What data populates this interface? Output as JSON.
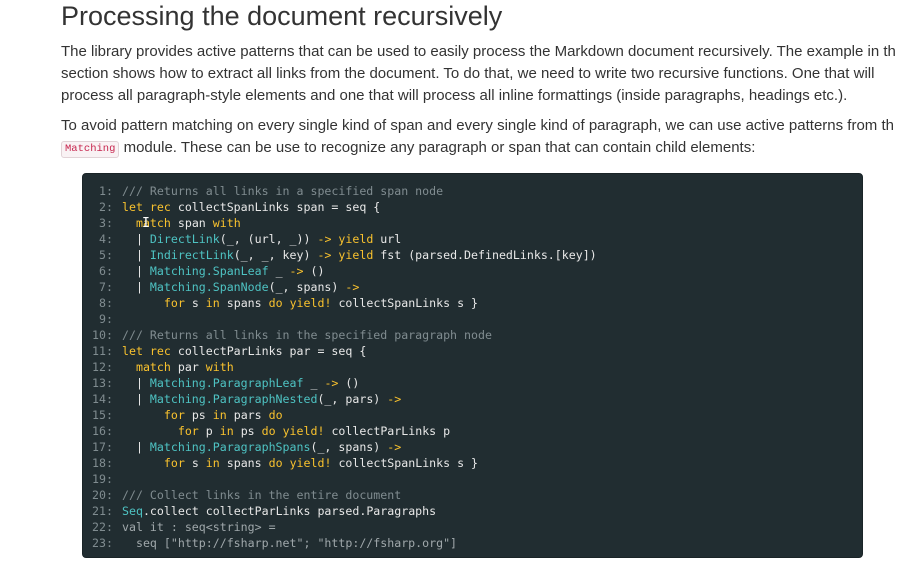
{
  "heading": "Processing the document recursively",
  "paragraph1": {
    "lines": [
      "The library provides active patterns that can be used to easily process the Markdown document recursively. The example in th",
      "section shows how to extract all links from the document. To do that, we need to write two recursive functions. One that will",
      "process all paragraph-style elements and one that will process all inline formattings (inside paragraphs, headings etc.)."
    ]
  },
  "paragraph2": {
    "line1": "To avoid pattern matching on every single kind of span and every single kind of paragraph, we can use active patterns from th",
    "inline_code": "Matching",
    "line2_rest": " module. These can be use to recognize any paragraph or span that can contain child elements:"
  },
  "code": {
    "lines": [
      {
        "n": "1:",
        "tokens": [
          [
            "com",
            "/// Returns all links in a specified span node"
          ]
        ]
      },
      {
        "n": "2:",
        "tokens": [
          [
            "kw",
            "let rec "
          ],
          [
            "id",
            "collectSpanLinks span = seq {"
          ]
        ]
      },
      {
        "n": "3:",
        "tokens": [
          [
            "id",
            "  "
          ],
          [
            "kw",
            "match "
          ],
          [
            "id",
            "span "
          ],
          [
            "kw",
            "with"
          ]
        ]
      },
      {
        "n": "4:",
        "tokens": [
          [
            "id",
            "  | "
          ],
          [
            "ty",
            "DirectLink"
          ],
          [
            "id",
            "(_, (url, _)) "
          ],
          [
            "kw",
            "-> yield "
          ],
          [
            "id",
            "url"
          ]
        ]
      },
      {
        "n": "5:",
        "tokens": [
          [
            "id",
            "  | "
          ],
          [
            "ty",
            "IndirectLink"
          ],
          [
            "id",
            "(_, _, key) "
          ],
          [
            "kw",
            "-> yield "
          ],
          [
            "id",
            "fst (parsed.DefinedLinks.[key])"
          ]
        ]
      },
      {
        "n": "6:",
        "tokens": [
          [
            "id",
            "  | "
          ],
          [
            "ty",
            "Matching.SpanLeaf"
          ],
          [
            "id",
            " _ "
          ],
          [
            "kw",
            "-> "
          ],
          [
            "id",
            "()"
          ]
        ]
      },
      {
        "n": "7:",
        "tokens": [
          [
            "id",
            "  | "
          ],
          [
            "ty",
            "Matching.SpanNode"
          ],
          [
            "id",
            "(_, spans) "
          ],
          [
            "kw",
            "->"
          ]
        ]
      },
      {
        "n": "8:",
        "tokens": [
          [
            "id",
            "      "
          ],
          [
            "kw",
            "for "
          ],
          [
            "id",
            "s "
          ],
          [
            "kw",
            "in "
          ],
          [
            "id",
            "spans "
          ],
          [
            "kw",
            "do yield! "
          ],
          [
            "id",
            "collectSpanLinks s }"
          ]
        ]
      },
      {
        "n": "9:",
        "tokens": []
      },
      {
        "n": "10:",
        "tokens": [
          [
            "com",
            "/// Returns all links in the specified paragraph node"
          ]
        ]
      },
      {
        "n": "11:",
        "tokens": [
          [
            "kw",
            "let rec "
          ],
          [
            "id",
            "collectParLinks par = seq {"
          ]
        ]
      },
      {
        "n": "12:",
        "tokens": [
          [
            "id",
            "  "
          ],
          [
            "kw",
            "match "
          ],
          [
            "id",
            "par "
          ],
          [
            "kw",
            "with"
          ]
        ]
      },
      {
        "n": "13:",
        "tokens": [
          [
            "id",
            "  | "
          ],
          [
            "ty",
            "Matching.ParagraphLeaf"
          ],
          [
            "id",
            " _ "
          ],
          [
            "kw",
            "-> "
          ],
          [
            "id",
            "()"
          ]
        ]
      },
      {
        "n": "14:",
        "tokens": [
          [
            "id",
            "  | "
          ],
          [
            "ty",
            "Matching.ParagraphNested"
          ],
          [
            "id",
            "(_, pars) "
          ],
          [
            "kw",
            "->"
          ]
        ]
      },
      {
        "n": "15:",
        "tokens": [
          [
            "id",
            "      "
          ],
          [
            "kw",
            "for "
          ],
          [
            "id",
            "ps "
          ],
          [
            "kw",
            "in "
          ],
          [
            "id",
            "pars "
          ],
          [
            "kw",
            "do"
          ]
        ]
      },
      {
        "n": "16:",
        "tokens": [
          [
            "id",
            "        "
          ],
          [
            "kw",
            "for "
          ],
          [
            "id",
            "p "
          ],
          [
            "kw",
            "in "
          ],
          [
            "id",
            "ps "
          ],
          [
            "kw",
            "do yield! "
          ],
          [
            "id",
            "collectParLinks p"
          ]
        ]
      },
      {
        "n": "17:",
        "tokens": [
          [
            "id",
            "  | "
          ],
          [
            "ty",
            "Matching.ParagraphSpans"
          ],
          [
            "id",
            "(_, spans) "
          ],
          [
            "kw",
            "->"
          ]
        ]
      },
      {
        "n": "18:",
        "tokens": [
          [
            "id",
            "      "
          ],
          [
            "kw",
            "for "
          ],
          [
            "id",
            "s "
          ],
          [
            "kw",
            "in "
          ],
          [
            "id",
            "spans "
          ],
          [
            "kw",
            "do yield! "
          ],
          [
            "id",
            "collectSpanLinks s }"
          ]
        ]
      },
      {
        "n": "19:",
        "tokens": []
      },
      {
        "n": "20:",
        "tokens": [
          [
            "com",
            "/// Collect links in the entire document"
          ]
        ]
      },
      {
        "n": "21:",
        "tokens": [
          [
            "ty",
            "Seq"
          ],
          [
            "id",
            ".collect collectParLinks parsed.Paragraphs"
          ]
        ]
      },
      {
        "n": "22:",
        "tokens": [
          [
            "out",
            "val it : seq<string> ="
          ]
        ]
      },
      {
        "n": "23:",
        "tokens": [
          [
            "out",
            "  seq [\"http://fsharp.net\"; \"http://fsharp.org\"]"
          ]
        ]
      }
    ]
  },
  "colors": {
    "code_background": "#212d31",
    "keyword": "#f9c22e",
    "type": "#4ec3c3",
    "comment": "#808c90",
    "inline_code_text": "#c7254e"
  },
  "cursor": {
    "icon": "text-cursor-icon",
    "glyph": "I"
  }
}
